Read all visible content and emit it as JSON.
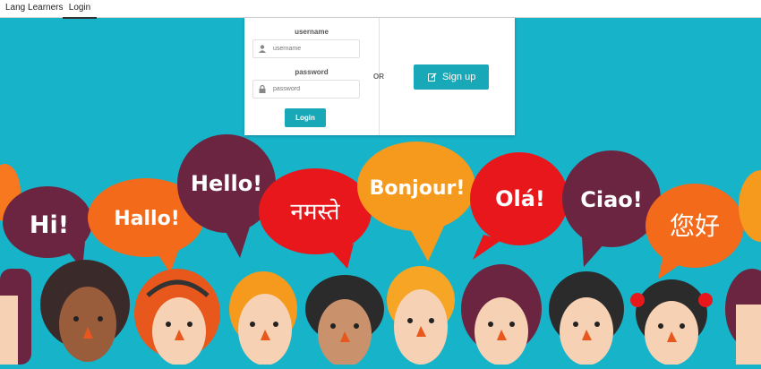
{
  "nav": {
    "brand": "Lang Learners",
    "login": "Login"
  },
  "login_form": {
    "username_label": "username",
    "username_placeholder": "username",
    "password_label": "password",
    "password_placeholder": "password",
    "login_button": "Login",
    "or_text": "OR",
    "signup_button": "Sign up"
  },
  "greetings": [
    "Hi!",
    "Hallo!",
    "Hello!",
    "नमस्ते",
    "Bonjour!",
    "Olá!",
    "Ciao!",
    "您好"
  ],
  "colors": {
    "background": "#17b3c9",
    "accent": "#18a8b8"
  }
}
